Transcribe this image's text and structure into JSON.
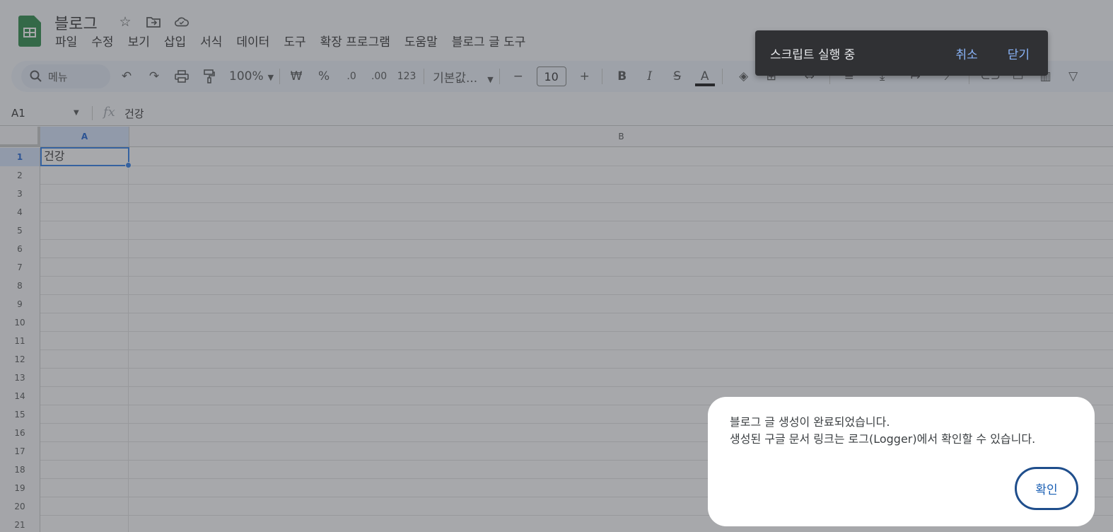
{
  "document": {
    "title": "블로그"
  },
  "menu": [
    "파일",
    "수정",
    "보기",
    "삽입",
    "서식",
    "데이터",
    "도구",
    "확장 프로그램",
    "도움말",
    "블로그 글 도구"
  ],
  "toolbar": {
    "search_label": "메뉴",
    "zoom": "100%",
    "currency": "₩",
    "percent": "%",
    "decimal_decrease": ".0",
    "decimal_increase": ".00",
    "number_format": "123",
    "font_family": "기본값...",
    "font_size": "10",
    "bold": "B",
    "italic": "I",
    "strike": "S",
    "text_color": "A"
  },
  "formula_bar": {
    "name_box": "A1",
    "fx_label": "fx",
    "value": "건강"
  },
  "grid": {
    "columns": [
      "A",
      "B"
    ],
    "rows": [
      "1",
      "2",
      "3",
      "4",
      "5",
      "6",
      "7",
      "8",
      "9",
      "10",
      "11",
      "12",
      "13",
      "14",
      "15",
      "16",
      "17",
      "18",
      "19",
      "20",
      "21"
    ],
    "cell_a1": "건강"
  },
  "snackbar": {
    "message": "스크립트 실행 중",
    "cancel_label": "취소",
    "close_label": "닫기"
  },
  "dialog": {
    "line1": "블로그 글 생성이 완료되었습니다.",
    "line2": "생성된 구글 문서 링크는 로그(Logger)에서 확인할 수 있습니다.",
    "ok_label": "확인"
  }
}
